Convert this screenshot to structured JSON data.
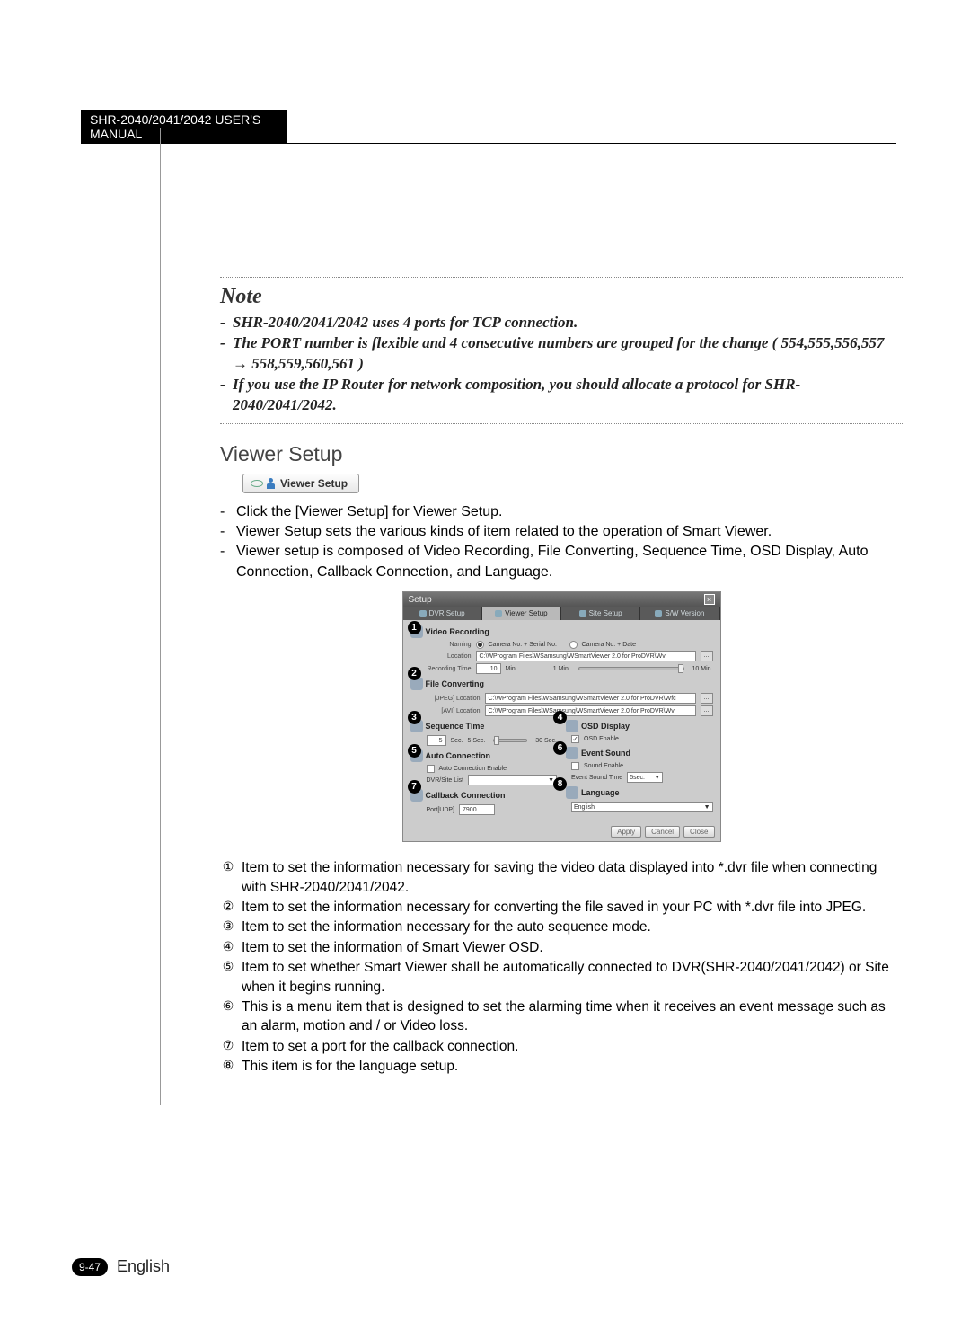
{
  "header": "SHR-2040/2041/2042 USER'S MANUAL",
  "note": {
    "title": "Note",
    "items": [
      "SHR-2040/2041/2042 uses 4 ports for TCP connection.",
      "The PORT number is flexible and 4 consecutive numbers are grouped for the change ( 554,555,556,557 → 558,559,560,561 )",
      "If you use the IP Router for network composition, you should allocate a protocol for SHR-2040/2041/2042."
    ]
  },
  "section_title": "Viewer Setup",
  "viewer_button_label": "Viewer Setup",
  "intro_items": [
    "Click the [Viewer Setup] for Viewer Setup.",
    "Viewer Setup sets the various kinds of item related to the operation of Smart Viewer.",
    "Viewer setup is composed of Video Recording, File Converting, Sequence Time, OSD Display, Auto Connection, Callback Connection, and Language."
  ],
  "dialog": {
    "title": "Setup",
    "tabs": [
      "DVR Setup",
      "Viewer Setup",
      "Site Setup",
      "S/W Version"
    ],
    "active_tab_index": 1,
    "video_recording": {
      "title": "Video Recording",
      "naming_label": "Naming",
      "naming_opt1": "Camera No. + Serial No.",
      "naming_opt2": "Camera No. + Date",
      "location_label": "Location",
      "location_value": "C:\\WProgram Files\\WSamsung\\WSmartViewer 2.0 for ProDVR\\Wv",
      "rectime_label": "Recording Time",
      "rectime_value": "10",
      "rectime_unit": "Min.",
      "rectime_min": "1 Min.",
      "rectime_max": "10 Min."
    },
    "file_converting": {
      "title": "File Converting",
      "jpeg_label": "[JPEG]    Location",
      "jpeg_value": "C:\\WProgram Files\\WSamsung\\WSmartViewer 2.0 for ProDVR\\Wfc",
      "avi_label": "[AVI]      Location",
      "avi_value": "C:\\WProgram Files\\WSamsung\\WSmartViewer 2.0 for ProDVR\\Wv"
    },
    "sequence_time": {
      "title": "Sequence Time",
      "value": "5",
      "unit": "Sec.",
      "min": "5 Sec.",
      "max": "30 Sec."
    },
    "osd_display": {
      "title": "OSD Display",
      "enable_label": "OSD Enable"
    },
    "auto_connection": {
      "title": "Auto Connection",
      "enable_label": "Auto Connection Enable",
      "list_label": "DVR/Site List"
    },
    "event_sound": {
      "title": "Event Sound",
      "enable_label": "Sound Enable",
      "time_label": "Event Sound Time",
      "time_value": "5sec."
    },
    "callback": {
      "title": "Callback Connection",
      "port_label": "Port[UDP]",
      "port_value": "7900"
    },
    "language": {
      "title": "Language",
      "value": "English"
    },
    "buttons": {
      "apply": "Apply",
      "cancel": "Cancel",
      "close": "Close"
    }
  },
  "desc_bullets": {
    "1": "Item to set the information necessary for saving the video data displayed into *.dvr file when connecting with SHR-2040/2041/2042.",
    "2": "Item to set the information necessary for converting the file saved in your PC with *.dvr file into JPEG.",
    "3": "Item to set the information necessary for the auto sequence mode.",
    "4": "Item to set the information of Smart Viewer OSD.",
    "5": "Item to set whether Smart Viewer shall be automatically connected to DVR(SHR-2040/2041/2042) or Site when it begins running.",
    "6": "This is a menu item that is designed to set the alarming time when it receives an event message such as an alarm, motion and / or Video loss.",
    "7": "Item to set a port for the callback connection.",
    "8": "This item is for the language setup."
  },
  "circled": {
    "1": "①",
    "2": "②",
    "3": "③",
    "4": "④",
    "5": "⑤",
    "6": "⑥",
    "7": "⑦",
    "8": "⑧"
  },
  "footer": {
    "page": "9-47",
    "lang": "English"
  }
}
